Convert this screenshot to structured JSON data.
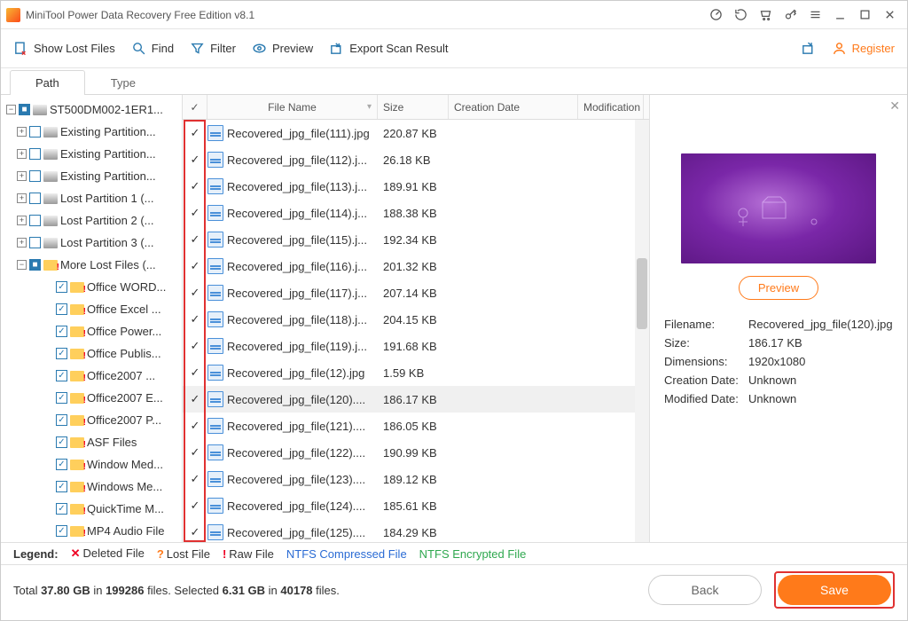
{
  "window": {
    "title": "MiniTool Power Data Recovery Free Edition v8.1"
  },
  "toolbar": {
    "showLost": "Show Lost Files",
    "find": "Find",
    "filter": "Filter",
    "preview": "Preview",
    "export": "Export Scan Result",
    "register": "Register"
  },
  "tabs": {
    "path": "Path",
    "type": "Type"
  },
  "tree": {
    "root": "ST500DM002-1ER1...",
    "items": [
      "Existing Partition...",
      "Existing Partition...",
      "Existing Partition...",
      "Lost Partition 1 (...",
      "Lost Partition 2 (...",
      "Lost Partition 3 (...",
      "More Lost Files (..."
    ],
    "sub": [
      "Office WORD...",
      "Office Excel ...",
      "Office Power...",
      "Office Publis...",
      "Office2007 ...",
      "Office2007 E...",
      "Office2007 P...",
      "ASF Files",
      "Window Med...",
      "Windows Me...",
      "QuickTime M...",
      "MP4 Audio File"
    ]
  },
  "cols": {
    "name": "File Name",
    "size": "Size",
    "cdate": "Creation Date",
    "mdate": "Modification"
  },
  "files": [
    {
      "name": "Recovered_jpg_file(111).jpg",
      "size": "220.87 KB"
    },
    {
      "name": "Recovered_jpg_file(112).j...",
      "size": "26.18 KB"
    },
    {
      "name": "Recovered_jpg_file(113).j...",
      "size": "189.91 KB"
    },
    {
      "name": "Recovered_jpg_file(114).j...",
      "size": "188.38 KB"
    },
    {
      "name": "Recovered_jpg_file(115).j...",
      "size": "192.34 KB"
    },
    {
      "name": "Recovered_jpg_file(116).j...",
      "size": "201.32 KB"
    },
    {
      "name": "Recovered_jpg_file(117).j...",
      "size": "207.14 KB"
    },
    {
      "name": "Recovered_jpg_file(118).j...",
      "size": "204.15 KB"
    },
    {
      "name": "Recovered_jpg_file(119).j...",
      "size": "191.68 KB"
    },
    {
      "name": "Recovered_jpg_file(12).jpg",
      "size": "1.59 KB"
    },
    {
      "name": "Recovered_jpg_file(120)....",
      "size": "186.17 KB",
      "selected": true
    },
    {
      "name": "Recovered_jpg_file(121)....",
      "size": "186.05 KB"
    },
    {
      "name": "Recovered_jpg_file(122)....",
      "size": "190.99 KB"
    },
    {
      "name": "Recovered_jpg_file(123)....",
      "size": "189.12 KB"
    },
    {
      "name": "Recovered_jpg_file(124)....",
      "size": "185.61 KB"
    },
    {
      "name": "Recovered_jpg_file(125)....",
      "size": "184.29 KB"
    }
  ],
  "preview": {
    "btn": "Preview",
    "filename_k": "Filename:",
    "filename_v": "Recovered_jpg_file(120).jpg",
    "size_k": "Size:",
    "size_v": "186.17 KB",
    "dim_k": "Dimensions:",
    "dim_v": "1920x1080",
    "cdate_k": "Creation Date:",
    "cdate_v": "Unknown",
    "mdate_k": "Modified Date:",
    "mdate_v": "Unknown"
  },
  "legend": {
    "label": "Legend:",
    "del": "Deleted File",
    "lost": "Lost File",
    "raw": "Raw File",
    "ntfs": "NTFS Compressed File",
    "enc": "NTFS Encrypted File"
  },
  "status": {
    "prefix": "Total ",
    "total_size": "37.80 GB",
    "mid1": " in ",
    "total_files": "199286",
    "mid2": " files.  Selected ",
    "sel_size": "6.31 GB",
    "mid3": " in ",
    "sel_files": "40178",
    "suffix": " files."
  },
  "buttons": {
    "back": "Back",
    "save": "Save"
  }
}
